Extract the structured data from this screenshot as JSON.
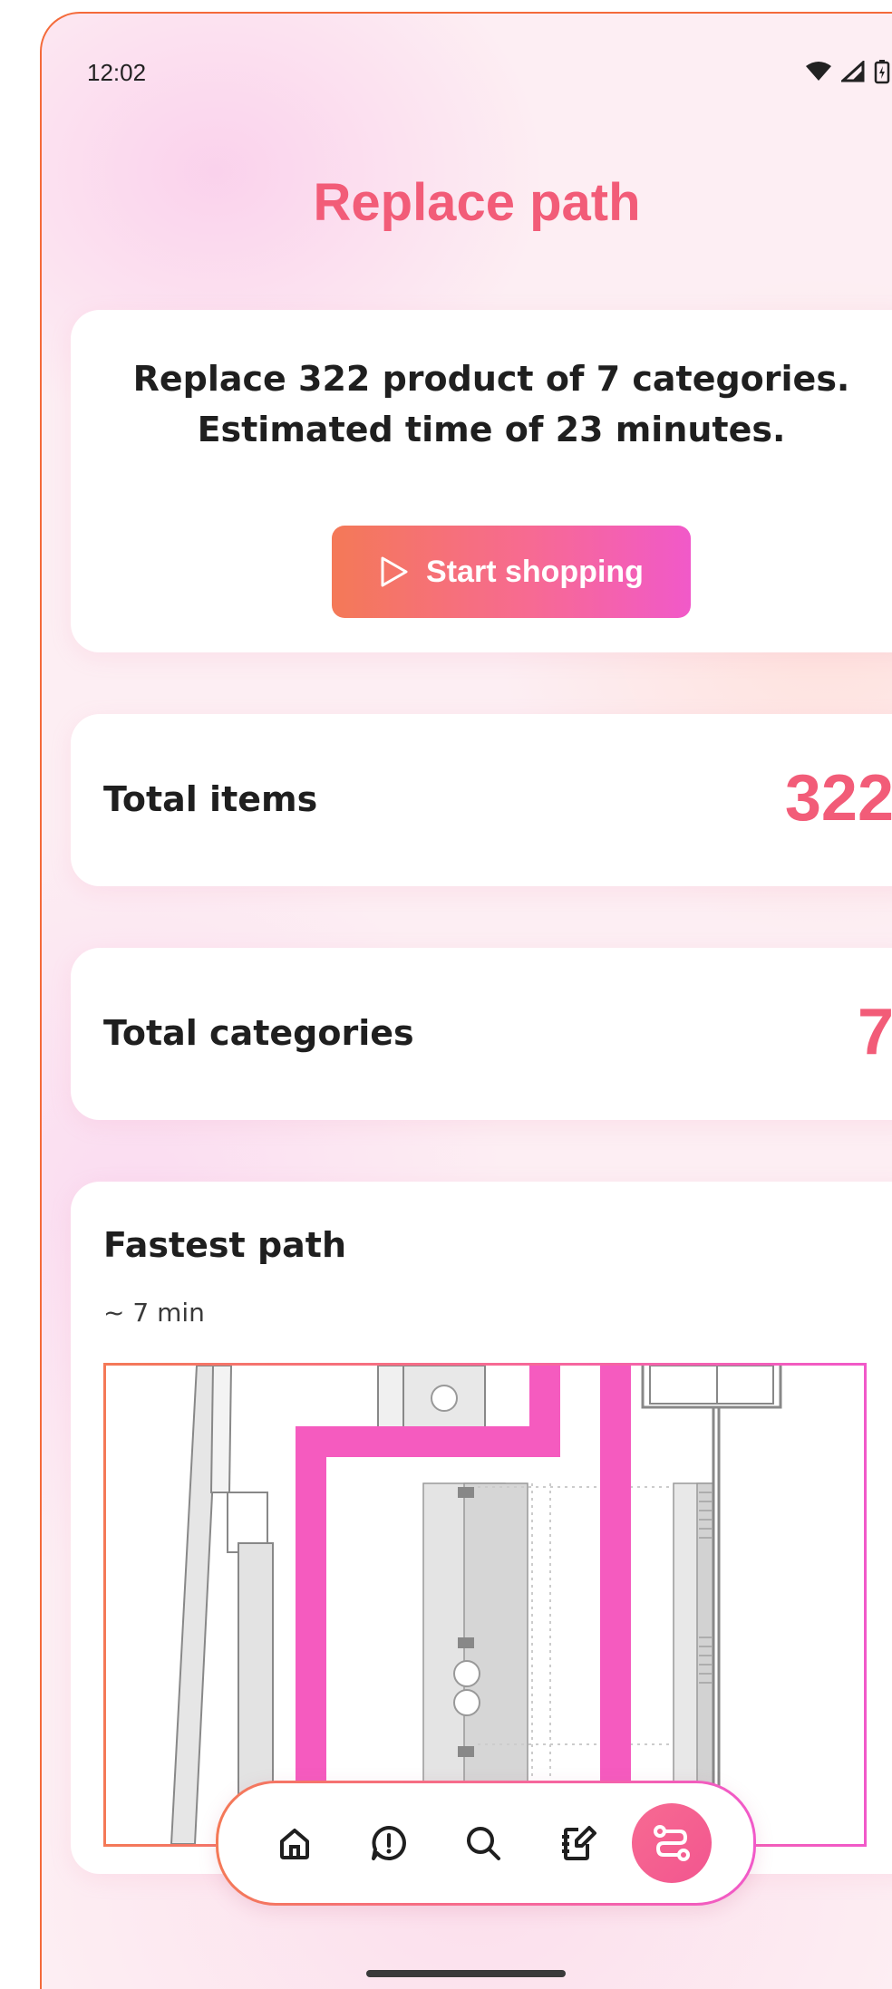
{
  "status": {
    "time": "12:02"
  },
  "page": {
    "title": "Replace path"
  },
  "hero": {
    "description": "Replace 322 product of 7 categories. Estimated time of 23 minutes.",
    "button_label": "Start shopping"
  },
  "stats": {
    "items_label": "Total items",
    "items_value": "322",
    "categories_label": "Total categories",
    "categories_value": "7"
  },
  "path": {
    "title": "Fastest path",
    "duration": "~ 7 min"
  },
  "nav": {
    "items": [
      {
        "icon": "home-icon",
        "active": false
      },
      {
        "icon": "alert-bubble-icon",
        "active": false
      },
      {
        "icon": "search-icon",
        "active": false
      },
      {
        "icon": "notebook-edit-icon",
        "active": false
      },
      {
        "icon": "route-icon",
        "active": true
      }
    ]
  },
  "colors": {
    "accent": "#f25c78",
    "gradient_start": "#f47957",
    "gradient_end": "#f159c9",
    "path_line": "#f55bbf"
  }
}
